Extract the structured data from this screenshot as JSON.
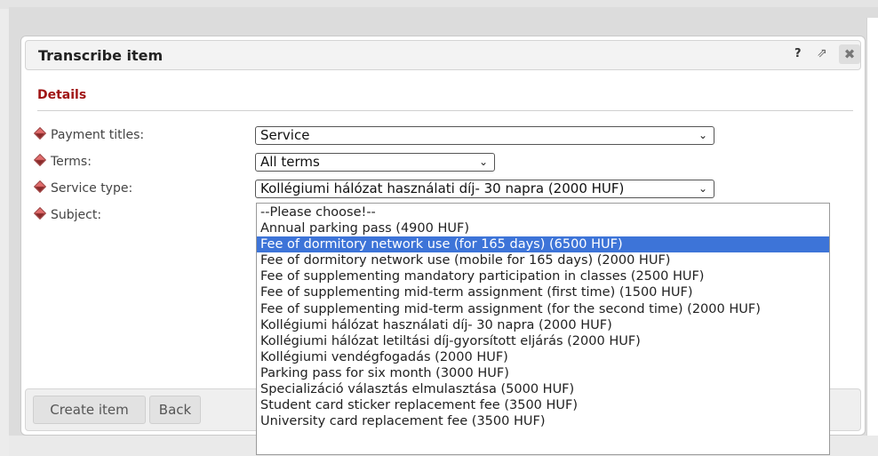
{
  "dialog": {
    "title": "Transcribe item",
    "help_symbol": "?",
    "popout_symbol": "⇗",
    "close_symbol": "✖"
  },
  "details": {
    "section_title": "Details",
    "fields": [
      {
        "label": "Payment titles:",
        "value": "Service"
      },
      {
        "label": "Terms:",
        "value": "All terms"
      },
      {
        "label": "Service type:",
        "value": "Kollégiumi hálózat használati díj- 30 napra (2000 HUF)"
      },
      {
        "label": "Subject:",
        "value": ""
      }
    ]
  },
  "dropdown": {
    "selected_index": 2,
    "options": [
      "--Please choose!--",
      "Annual parking pass (4900 HUF)",
      "Fee of dormitory network use (for 165 days) (6500 HUF)",
      "Fee of dormitory network use (mobile for 165 days) (2000 HUF)",
      "Fee of supplementing mandatory participation in classes (2500 HUF)",
      "Fee of supplementing mid-term assignment (first time) (1500 HUF)",
      "Fee of supplementing mid-term assignment (for the second time) (2000 HUF)",
      "Kollégiumi hálózat használati díj- 30 napra (2000 HUF)",
      "Kollégiumi hálózat letiltási díj-gyorsított eljárás (2000 HUF)",
      "Kollégiumi vendégfogadás (2000 HUF)",
      "Parking pass for six month (3000 HUF)",
      "Specializáció választás elmulasztása (5000 HUF)",
      "Student card sticker replacement fee (3500 HUF)",
      "University card replacement fee (3500 HUF)"
    ]
  },
  "footer": {
    "create_label": "Create item",
    "back_label": "Back"
  },
  "icons": {
    "chevron": "chevron-down-icon",
    "field_marker": "diamond-icon"
  },
  "colors": {
    "section_title": "#a01515",
    "selected_option": "#3d74d8"
  }
}
